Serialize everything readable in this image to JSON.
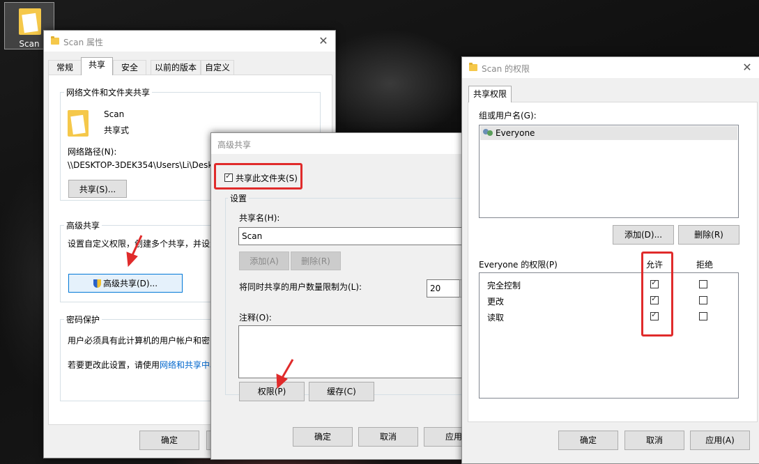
{
  "desktop": {
    "icon_label": "Scan"
  },
  "props_window": {
    "title": "Scan 属性",
    "tabs": [
      "常规",
      "共享",
      "安全",
      "以前的版本",
      "自定义"
    ],
    "active_tab": "共享",
    "network_group_label": "网络文件和文件夹共享",
    "folder_name": "Scan",
    "folder_status": "共享式",
    "network_path_label": "网络路径(N):",
    "network_path_value": "\\\\DESKTOP-3DEK354\\Users\\Li\\Desk",
    "share_button": "共享(S)...",
    "advanced_group_label": "高级共享",
    "advanced_desc": "设置自定义权限，创建多个共享，并设置",
    "advanced_button": "高级共享(D)...",
    "password_group_label": "密码保护",
    "password_desc": "用户必须具有此计算机的用户帐户和密",
    "password_change_prefix": "若要更改此设置，请使用",
    "password_link": "网络和共享中心",
    "ok_button": "确定"
  },
  "advanced_window": {
    "title": "高级共享",
    "share_checkbox_label": "共享此文件夹(S)",
    "settings_label": "设置",
    "share_name_label": "共享名(H):",
    "share_name_value": "Scan",
    "add_button": "添加(A)",
    "remove_button": "删除(R)",
    "limit_label": "将同时共享的用户数量限制为(L):",
    "limit_value": "20",
    "comment_label": "注释(O):",
    "permissions_button": "权限(P)",
    "caching_button": "缓存(C)",
    "ok_button": "确定",
    "cancel_button": "取消",
    "apply_button": "应用"
  },
  "perm_window": {
    "title": "Scan 的权限",
    "tab": "共享权限",
    "group_label": "组或用户名(G):",
    "users": [
      "Everyone"
    ],
    "add_button": "添加(D)...",
    "remove_button": "删除(R)",
    "perm_header": "Everyone 的权限(P)",
    "allow_header": "允许",
    "deny_header": "拒绝",
    "permissions": [
      {
        "name": "完全控制",
        "allow": true,
        "deny": false
      },
      {
        "name": "更改",
        "allow": true,
        "deny": false
      },
      {
        "name": "读取",
        "allow": true,
        "deny": false
      }
    ],
    "ok_button": "确定",
    "cancel_button": "取消",
    "apply_button": "应用(A)"
  },
  "colors": {
    "highlight": "#e02b2b",
    "arrow": "#e02b2b",
    "link": "#0066cc"
  }
}
